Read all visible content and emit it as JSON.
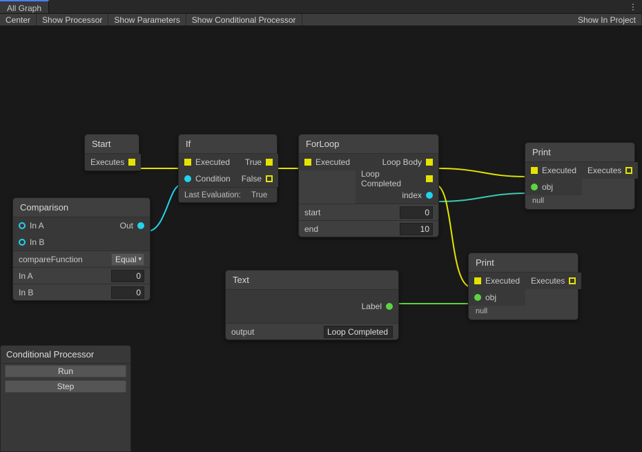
{
  "tab": {
    "label": "All Graph"
  },
  "toolbar": {
    "center": "Center",
    "show_processor": "Show Processor",
    "show_parameters": "Show Parameters",
    "show_conditional": "Show Conditional Processor",
    "show_in_project": "Show In Project"
  },
  "nodes": {
    "start": {
      "title": "Start",
      "executes": "Executes"
    },
    "if": {
      "title": "If",
      "executed": "Executed",
      "condition": "Condition",
      "true": "True",
      "false": "False",
      "last_eval_label": "Last Evaluation:",
      "last_eval_value": "True"
    },
    "comparison": {
      "title": "Comparison",
      "in_a": "In A",
      "in_b": "In B",
      "out": "Out",
      "compare_label": "compareFunction",
      "compare_value": "Equal",
      "in_a_param": "In A",
      "in_a_val": "0",
      "in_b_param": "In B",
      "in_b_val": "0"
    },
    "forloop": {
      "title": "ForLoop",
      "executed": "Executed",
      "loop_body": "Loop Body",
      "loop_completed": "Loop Completed",
      "index": "index",
      "start_label": "start",
      "start_val": "0",
      "end_label": "end",
      "end_val": "10"
    },
    "text": {
      "title": "Text",
      "label": "Label",
      "output_label": "output",
      "output_val": "Loop Completed"
    },
    "print1": {
      "title": "Print",
      "executed": "Executed",
      "executes": "Executes",
      "obj": "obj",
      "null": "null"
    },
    "print2": {
      "title": "Print",
      "executed": "Executed",
      "executes": "Executes",
      "obj": "obj",
      "null": "null"
    }
  },
  "cp": {
    "title": "Conditional Processor",
    "run": "Run",
    "step": "Step"
  }
}
